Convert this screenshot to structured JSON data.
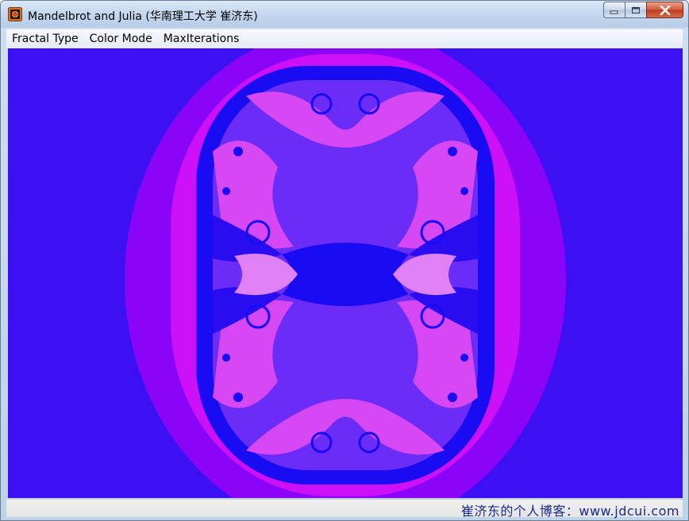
{
  "window": {
    "title": "Mandelbrot and Julia (华南理工大学 崔济东)",
    "icons": {
      "app": "fractal-app-icon",
      "minimize": "minimize-icon",
      "maximize": "maximize-icon",
      "close": "close-icon"
    }
  },
  "menu": {
    "items": [
      {
        "label": "Fractal Type"
      },
      {
        "label": "Color Mode"
      },
      {
        "label": "MaxIterations"
      }
    ]
  },
  "canvas": {
    "content": "julia-set-fractal",
    "colors": {
      "background": "#3d10f3",
      "halo": "#8a05f8",
      "outer_band": "#cc10f8",
      "dark_blue": "#1a0cf2",
      "violet": "#6a2cf6",
      "pink": "#d548f4",
      "light_pink": "#e080f5"
    }
  },
  "status": {
    "text": "崔济东的个人博客：www.jdcui.com"
  }
}
